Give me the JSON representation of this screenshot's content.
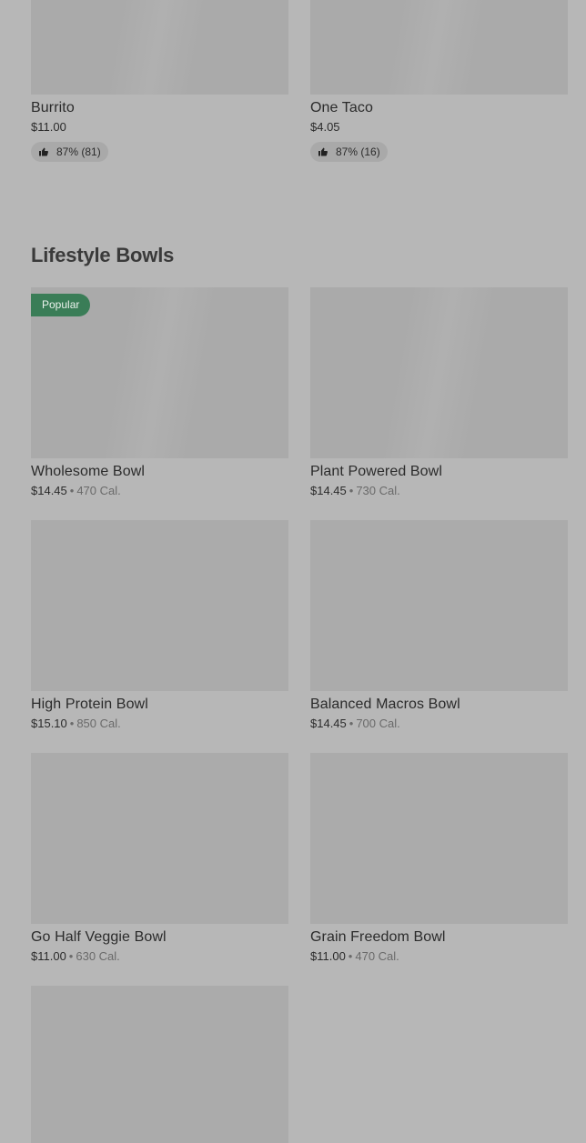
{
  "top_items": [
    {
      "name": "Burrito",
      "price": "$11.00",
      "rating": "87% (81)"
    },
    {
      "name": "One Taco",
      "price": "$4.05",
      "rating": "87% (16)"
    }
  ],
  "section": {
    "title": "Lifestyle Bowls",
    "items": [
      {
        "name": "Wholesome Bowl",
        "price": "$14.45",
        "calories": "470 Cal.",
        "badge": "Popular"
      },
      {
        "name": "Plant Powered Bowl",
        "price": "$14.45",
        "calories": "730 Cal."
      },
      {
        "name": "High Protein Bowl",
        "price": "$15.10",
        "calories": "850 Cal."
      },
      {
        "name": "Balanced Macros Bowl",
        "price": "$14.45",
        "calories": "700 Cal."
      },
      {
        "name": "Go Half Veggie Bowl",
        "price": "$11.00",
        "calories": "630 Cal."
      },
      {
        "name": "Grain Freedom Bowl",
        "price": "$11.00",
        "calories": "470 Cal."
      }
    ]
  },
  "separator": "•",
  "colors": {
    "background": "#b7b7b7",
    "placeholder": "#ababab",
    "badge": "#3a7d57"
  },
  "icons": {
    "rating": "thumbs-up-icon"
  }
}
